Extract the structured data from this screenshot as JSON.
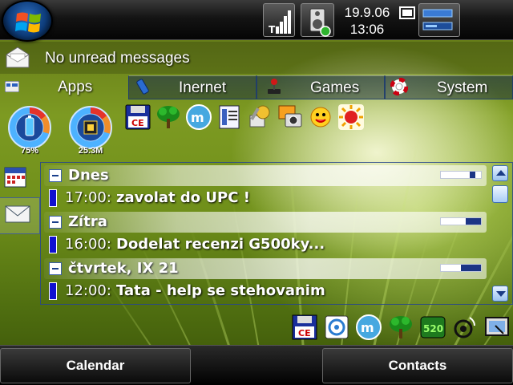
{
  "status_bar": {
    "date": "19.9.06",
    "time": "13:06"
  },
  "notification": {
    "text": "No unread messages",
    "icon": "envelope-icon"
  },
  "tabs": [
    {
      "label": "Apps",
      "icon": "apps-icon",
      "active": true
    },
    {
      "label": "Inernet",
      "icon": "phone-icon",
      "active": false
    },
    {
      "label": "Games",
      "icon": "joystick-icon",
      "active": false
    },
    {
      "label": "System",
      "icon": "lifebuoy-icon",
      "active": false
    }
  ],
  "gauges": [
    {
      "label": "75%",
      "icon": "battery-icon",
      "level": 0.75
    },
    {
      "label": "25.3M",
      "icon": "memory-chip-icon"
    }
  ],
  "app_icons": [
    "ce-floppy-icon",
    "tree-icon",
    "messenger-icon",
    "notes-icon",
    "tools-icon",
    "camera-icon",
    "smiley-icon",
    "sun-icon"
  ],
  "agenda": {
    "days": [
      {
        "name": "Dnes",
        "events": [
          {
            "time": "17:00:",
            "title": "zavolat do UPC !"
          }
        ],
        "busy": {
          "start": 0.72,
          "end": 0.86
        }
      },
      {
        "name": "Zítra",
        "events": [
          {
            "time": "16:00:",
            "title": "Dodelat recenzi G500ky..."
          }
        ],
        "busy": {
          "start": 0.62,
          "end": 1.0
        }
      },
      {
        "name": "čtvrtek, IX 21",
        "events": [
          {
            "time": "12:00:",
            "title": "Tata - help se stehovanim"
          }
        ],
        "busy": {
          "start": 0.5,
          "end": 1.0
        }
      }
    ]
  },
  "tray_icons": [
    "ce-floppy-icon",
    "sync-icon",
    "messenger-icon",
    "tree-icon",
    "counter-520-icon",
    "wireless-icon",
    "screen-icon"
  ],
  "tray_counter_text": "520",
  "softkeys": {
    "left": "Calendar",
    "right": "Contacts"
  },
  "colors": {
    "accent_blue": "#1c3585",
    "event_marker": "#1010d0"
  }
}
